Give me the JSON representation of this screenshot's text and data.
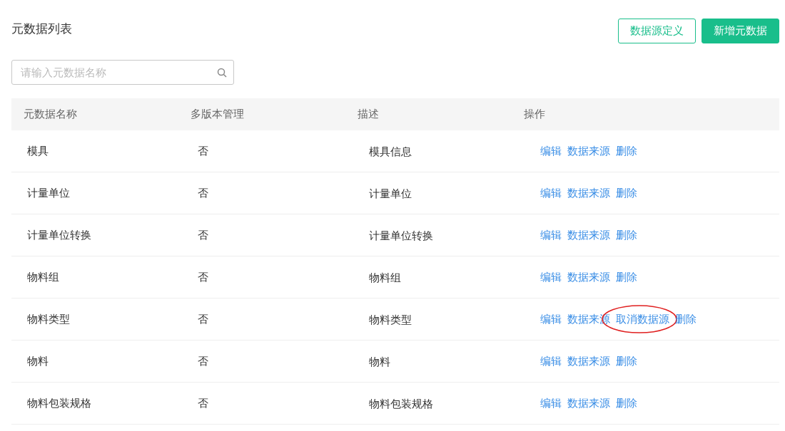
{
  "page_title": "元数据列表",
  "buttons": [
    {
      "label": "数据源定义",
      "kind": "outline"
    },
    {
      "label": "新增元数据",
      "kind": "solid"
    }
  ],
  "search": {
    "placeholder": "请输入元数据名称"
  },
  "table": {
    "columns": [
      "元数据名称",
      "多版本管理",
      "描述",
      "操作"
    ],
    "rows": [
      {
        "name": "模具",
        "multi_version": "否",
        "description": "模具信息",
        "actions": [
          {
            "label": "编辑",
            "highlighted": false
          },
          {
            "label": "数据来源",
            "highlighted": false
          },
          {
            "label": "删除",
            "highlighted": false
          }
        ]
      },
      {
        "name": "计量单位",
        "multi_version": "否",
        "description": "计量单位",
        "actions": [
          {
            "label": "编辑",
            "highlighted": false
          },
          {
            "label": "数据来源",
            "highlighted": false
          },
          {
            "label": "删除",
            "highlighted": false
          }
        ]
      },
      {
        "name": "计量单位转换",
        "multi_version": "否",
        "description": "计量单位转换",
        "actions": [
          {
            "label": "编辑",
            "highlighted": false
          },
          {
            "label": "数据来源",
            "highlighted": false
          },
          {
            "label": "删除",
            "highlighted": false
          }
        ]
      },
      {
        "name": "物料组",
        "multi_version": "否",
        "description": "物料组",
        "actions": [
          {
            "label": "编辑",
            "highlighted": false
          },
          {
            "label": "数据来源",
            "highlighted": false
          },
          {
            "label": "删除",
            "highlighted": false
          }
        ]
      },
      {
        "name": "物料类型",
        "multi_version": "否",
        "description": "物料类型",
        "actions": [
          {
            "label": "编辑",
            "highlighted": false
          },
          {
            "label": "数据来源",
            "highlighted": false
          },
          {
            "label": "取消数据源",
            "highlighted": true
          },
          {
            "label": "删除",
            "highlighted": false
          }
        ]
      },
      {
        "name": "物料",
        "multi_version": "否",
        "description": "物料",
        "actions": [
          {
            "label": "编辑",
            "highlighted": false
          },
          {
            "label": "数据来源",
            "highlighted": false
          },
          {
            "label": "删除",
            "highlighted": false
          }
        ]
      },
      {
        "name": "物料包装规格",
        "multi_version": "否",
        "description": "物料包装规格",
        "actions": [
          {
            "label": "编辑",
            "highlighted": false
          },
          {
            "label": "数据来源",
            "highlighted": false
          },
          {
            "label": "删除",
            "highlighted": false
          }
        ]
      }
    ]
  }
}
